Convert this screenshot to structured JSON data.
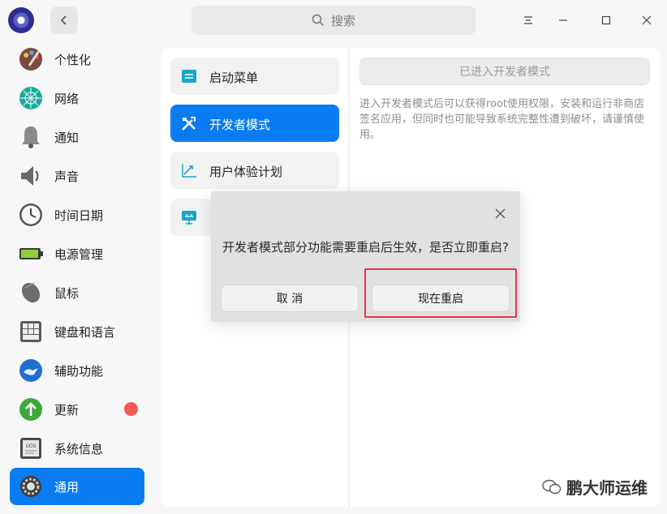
{
  "titlebar": {
    "search_placeholder": "搜索"
  },
  "sidebar": {
    "items": [
      {
        "label": "个性化",
        "icon": "personalization-icon"
      },
      {
        "label": "网络",
        "icon": "network-icon"
      },
      {
        "label": "通知",
        "icon": "bell-icon"
      },
      {
        "label": "声音",
        "icon": "speaker-icon"
      },
      {
        "label": "时间日期",
        "icon": "clock-icon"
      },
      {
        "label": "电源管理",
        "icon": "battery-icon"
      },
      {
        "label": "鼠标",
        "icon": "mouse-icon"
      },
      {
        "label": "键盘和语言",
        "icon": "keyboard-icon"
      },
      {
        "label": "辅助功能",
        "icon": "accessibility-icon"
      },
      {
        "label": "更新",
        "icon": "update-icon",
        "has_badge": true
      },
      {
        "label": "系统信息",
        "icon": "system-info-icon",
        "icon_text": "UOS"
      },
      {
        "label": "通用",
        "icon": "gear-icon",
        "active": true
      }
    ]
  },
  "middle": {
    "items": [
      {
        "label": "启动菜单",
        "icon": "boot-menu-icon"
      },
      {
        "label": "开发者模式",
        "icon": "tools-icon",
        "active": true
      },
      {
        "label": "用户体验计划",
        "icon": "chart-up-icon"
      },
      {
        "label": "",
        "icon": "diagnostics-icon"
      }
    ]
  },
  "right": {
    "developer_mode_button": "已进入开发者模式",
    "description": "进入开发者模式后可以获得root使用权限，安装和运行非商店签名应用，但同时也可能导致系统完整性遭到破坏，请谨慎使用。"
  },
  "dialog": {
    "message": "开发者模式部分功能需要重启后生效，是否立即重启?",
    "cancel_label": "取 消",
    "restart_label": "现在重启"
  },
  "watermark": {
    "text": "鹏大师运维"
  },
  "colors": {
    "accent": "#0a7cf2",
    "highlight": "#e6344e",
    "badge": "#f55a5a"
  }
}
